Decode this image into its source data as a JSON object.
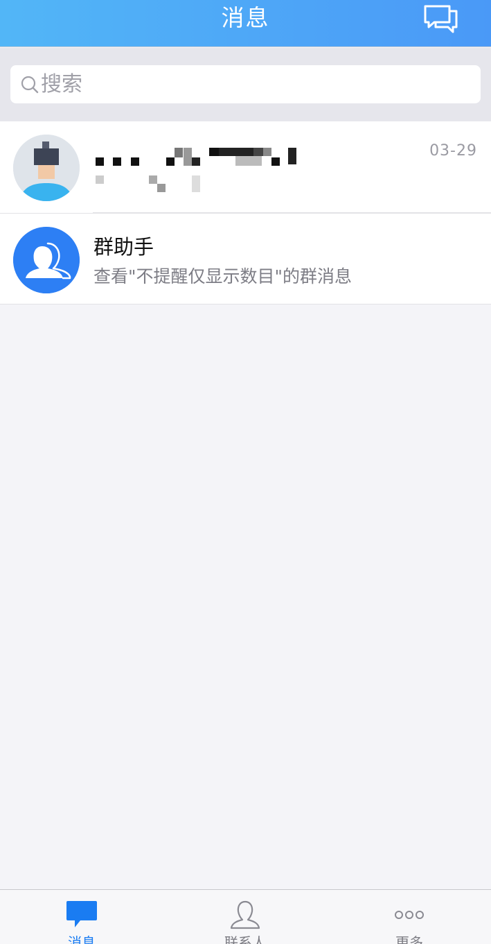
{
  "header": {
    "title": "消息",
    "chat_icon": "chat-bubbles-icon"
  },
  "search": {
    "placeholder": "搜索"
  },
  "conversations": [
    {
      "time": "03-29"
    },
    {
      "title": "群助手",
      "subtitle": "查看\"不提醒仅显示数目\"的群消息"
    }
  ],
  "tabbar": {
    "items": [
      {
        "label": "消息",
        "icon": "message-icon",
        "active": true
      },
      {
        "label": "联系人",
        "icon": "contact-icon",
        "active": false
      },
      {
        "label": "更多",
        "icon": "more-icon",
        "active": false
      }
    ]
  },
  "colors": {
    "accent": "#1a7cf2",
    "header_start": "#52b6f7",
    "header_end": "#4a99f7"
  }
}
